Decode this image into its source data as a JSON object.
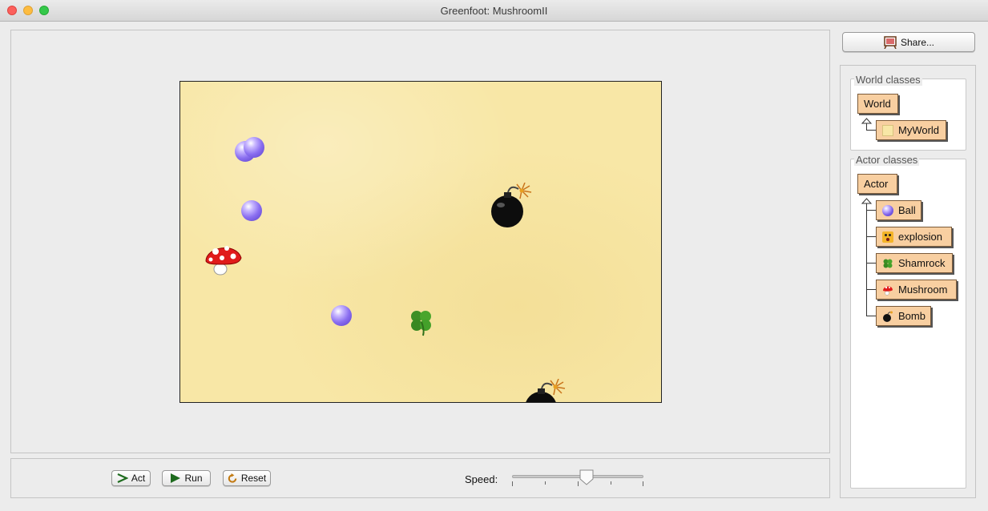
{
  "window": {
    "title": "Greenfoot: MushroomII"
  },
  "controls": {
    "act_label": "Act",
    "run_label": "Run",
    "reset_label": "Reset",
    "speed_label": "Speed:",
    "speed_value_fraction": 0.57
  },
  "sidebar": {
    "share_label": "Share...",
    "world_classes_label": "World classes",
    "actor_classes_label": "Actor classes",
    "world_classes": [
      {
        "label": "World"
      },
      {
        "label": "MyWorld"
      }
    ],
    "actor_classes": [
      {
        "label": "Actor"
      },
      {
        "label": "Ball"
      },
      {
        "label": "explosion"
      },
      {
        "label": "Shamrock"
      },
      {
        "label": "Mushroom"
      },
      {
        "label": "Bomb"
      }
    ]
  },
  "world_actors": [
    "ball",
    "ball",
    "ball",
    "ball",
    "mushroom",
    "shamrock",
    "bomb",
    "bomb"
  ],
  "colors": {
    "class_box": "#f8cfa1",
    "world_background": "#f8e7a6",
    "ball": "#8a6ef0"
  }
}
